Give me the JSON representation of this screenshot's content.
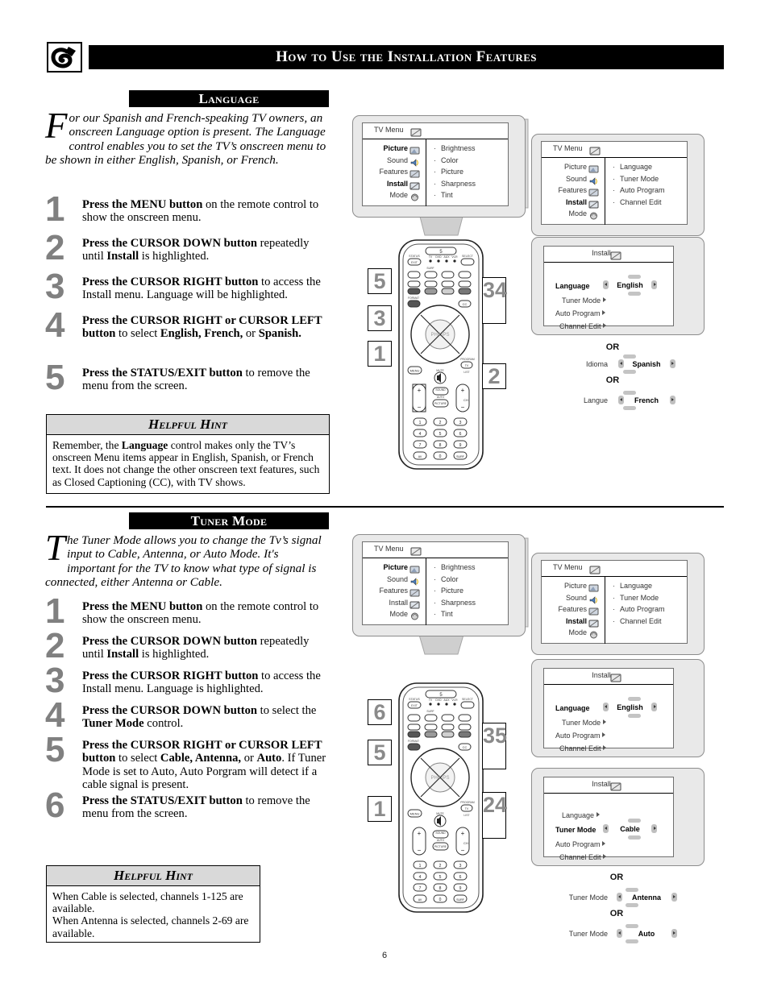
{
  "header": {
    "title": "How to Use the Installation Features",
    "icon": "remote-pointer-icon"
  },
  "page_number": "6",
  "sections": [
    {
      "id": "language",
      "title": "Language",
      "intro_dropcap": "F",
      "intro": "or our Spanish and French-speaking TV owners, an onscreen Language option is present. The Language control enables you to set the TV’s onscreen menu to be shown in either English, Spanish, or French.",
      "steps": [
        {
          "num": "1",
          "html": "<b>Press the MENU button</b> on the remote control to show the onscreen menu."
        },
        {
          "num": "2",
          "html": "<b>Press the CURSOR DOWN button</b> repeatedly until <b>Install</b> is highlighted."
        },
        {
          "num": "3",
          "html": "<b>Press the CURSOR RIGHT button</b> to access the Install menu.  Language will be highlighted."
        },
        {
          "num": "4",
          "html": "<b>Press the CURSOR RIGHT or CURSOR LEFT button</b> to select <b>English, French,</b> or <b>Spanish.</b>"
        },
        {
          "num": "5",
          "html": "<b>Press the STATUS/EXIT button</b> to remove the menu from the screen."
        }
      ],
      "hint": {
        "title": "Helpful Hint",
        "html": "Remember, the <b>Language</b> control makes only the TV’s onscreen Menu items appear in English, Spanish, or French text.  It does not change the other onscreen text features, such as Closed Captioning (CC), with TV shows."
      },
      "callouts_left": [
        "5",
        "3",
        "1"
      ],
      "callouts_right": [
        "3",
        "4",
        "2"
      ]
    },
    {
      "id": "tuner-mode",
      "title": "Tuner Mode",
      "intro_dropcap": "T",
      "intro": "he Tuner Mode allows you to change the Tv’s signal input to Cable, Antenna, or Auto Mode. It's important for the TV to know what type of signal is connected, either Antenna or Cable.",
      "steps": [
        {
          "num": "1",
          "html": "<b>Press the MENU button</b> on the remote control to show the onscreen menu."
        },
        {
          "num": "2",
          "html": "<b>Press the CURSOR DOWN button</b> repeatedly until <b>Install</b> is highlighted."
        },
        {
          "num": "3",
          "html": "<b>Press the CURSOR RIGHT button</b> to access the Install menu. Language is highlighted."
        },
        {
          "num": "4",
          "html": "<b>Press the CURSOR DOWN button</b> to select the <b>Tuner Mode</b> control."
        },
        {
          "num": "5",
          "html": "<b>Press the CURSOR RIGHT or CURSOR LEFT button</b> to select <b>Cable, Antenna,</b> or <b>Auto</b>. If Tuner Mode is set to Auto, Auto Porgram will detect if a cable signal is present."
        },
        {
          "num": "6",
          "html": "<b>Press the STATUS/EXIT button</b> to remove the menu from the screen."
        }
      ],
      "hint": {
        "title": "Helpful Hint",
        "html": "When Cable is selected, channels 1-125 are available.<br>When Antenna is selected, channels 2-69 are available."
      },
      "callouts_left": [
        "6",
        "5",
        "1"
      ],
      "callouts_right": [
        "3",
        "5",
        "2",
        "4"
      ]
    }
  ],
  "tv_menus": {
    "main": {
      "header": "TV Menu",
      "left_items": [
        {
          "label": "Picture",
          "icon": "picture-icon",
          "bold": true
        },
        {
          "label": "Sound",
          "icon": "sound-icon",
          "bold": false
        },
        {
          "label": "Features",
          "icon": "features-icon",
          "bold": false
        },
        {
          "label": "Install",
          "icon": "install-icon",
          "bold": true
        },
        {
          "label": "Mode",
          "icon": "mode-icon",
          "bold": false
        }
      ],
      "right_items": [
        "Brightness",
        "Color",
        "Picture",
        "Sharpness",
        "Tint"
      ]
    },
    "install_selected": {
      "header": "TV Menu",
      "left_items": [
        {
          "label": "Picture",
          "icon": "picture-icon",
          "bold": false
        },
        {
          "label": "Sound",
          "icon": "sound-icon",
          "bold": false
        },
        {
          "label": "Features",
          "icon": "features-icon",
          "bold": false
        },
        {
          "label": "Install",
          "icon": "install-icon",
          "bold": true
        },
        {
          "label": "Mode",
          "icon": "mode-icon",
          "bold": false
        }
      ],
      "right_items": [
        "Language",
        "Tuner Mode",
        "Auto Program",
        "Channel Edit"
      ]
    },
    "install_language": {
      "header": "Install",
      "rows": [
        {
          "label": "Language",
          "bold": true,
          "value": "English",
          "selectable": true
        },
        {
          "label": "Tuner Mode",
          "bold": false,
          "value": "",
          "selectable": false
        },
        {
          "label": "Auto Program",
          "bold": false,
          "value": "",
          "selectable": false
        },
        {
          "label": "Channel Edit",
          "bold": false,
          "value": "",
          "selectable": false
        }
      ]
    },
    "install_tuner": {
      "header": "Install",
      "rows": [
        {
          "label": "Language",
          "bold": false,
          "value": "",
          "selectable": false
        },
        {
          "label": "Tuner Mode",
          "bold": true,
          "value": "Cable",
          "selectable": true
        },
        {
          "label": "Auto Program",
          "bold": false,
          "value": "",
          "selectable": false
        },
        {
          "label": "Channel Edit",
          "bold": false,
          "value": "",
          "selectable": false
        }
      ]
    }
  },
  "alternatives": {
    "or_label": "OR",
    "language": [
      {
        "label": "Idioma",
        "value": "Spanish"
      },
      {
        "label": "Langue",
        "value": "French"
      }
    ],
    "tuner": [
      {
        "label": "Tuner Mode",
        "value": "Antenna"
      },
      {
        "label": "Tuner Mode",
        "value": "Auto"
      }
    ]
  },
  "remote": {
    "brand": "PHILIPS",
    "top_label": "5",
    "buttons": {
      "status_exit": "STATUS EXIT",
      "select": "SELECT",
      "menu": "MENU",
      "mute": "MUTE",
      "sound": "SOUND",
      "auto": "AUTO",
      "picture": "PICTURE",
      "volume": "VOL",
      "channel": "CH",
      "program": "PROGRAM",
      "surf": "SURF",
      "format": "FORMAT",
      "cc": "CC",
      "tv": "TV",
      "sources": [
        "TV",
        "DVD",
        "AUX",
        "VCR"
      ]
    },
    "keypad": [
      "1",
      "2",
      "3",
      "4",
      "5",
      "6",
      "7",
      "8",
      "9",
      "AV",
      "0",
      "SURF"
    ]
  }
}
